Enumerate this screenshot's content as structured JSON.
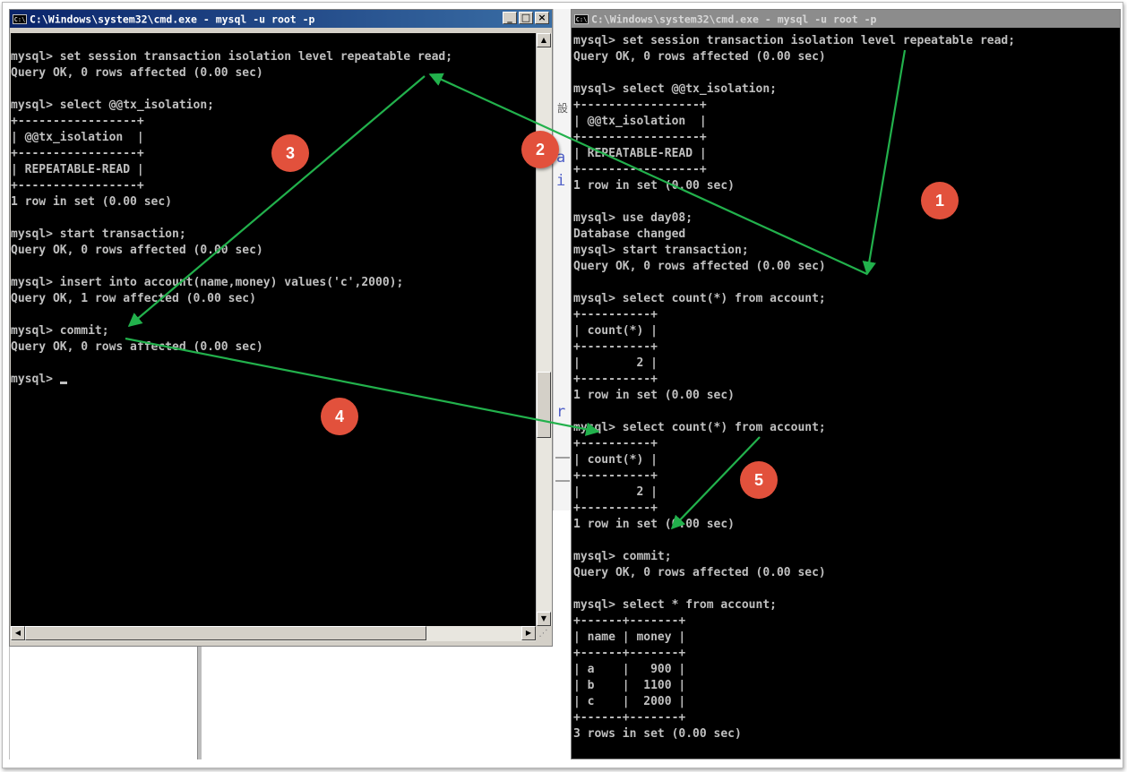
{
  "colors": {
    "terminal_bg": "#000000",
    "terminal_text": "#c0c0c0",
    "titlebar_active": "#0a246a",
    "titlebar_inactive": "#808080",
    "annotation_arrow": "#22b14c",
    "marker_fill": "#e2513c"
  },
  "icons": {
    "window_icon": "cmd-window-icon",
    "minimize": "minimize-icon",
    "maximize": "maximize-icon",
    "close": "close-icon"
  },
  "left_window": {
    "title": "C:\\Windows\\system32\\cmd.exe - mysql  -u root -p",
    "icon_text": "C:\\",
    "btn_min": "_",
    "btn_max": "□",
    "btn_close": "×",
    "lines": [
      "",
      "mysql> set session transaction isolation level repeatable read;",
      "Query OK, 0 rows affected (0.00 sec)",
      "",
      "mysql> select @@tx_isolation;",
      "+-----------------+",
      "| @@tx_isolation  |",
      "+-----------------+",
      "| REPEATABLE-READ |",
      "+-----------------+",
      "1 row in set (0.00 sec)",
      "",
      "mysql> start transaction;",
      "Query OK, 0 rows affected (0.00 sec)",
      "",
      "mysql> insert into account(name,money) values('c',2000);",
      "Query OK, 1 row affected (0.00 sec)",
      "",
      "mysql> commit;",
      "Query OK, 0 rows affected (0.00 sec)",
      "",
      "mysql> "
    ]
  },
  "right_window": {
    "title": "C:\\Windows\\system32\\cmd.exe - mysql  -u root -p",
    "icon_text": "C:\\",
    "lines": [
      "mysql> set session transaction isolation level repeatable read;",
      "Query OK, 0 rows affected (0.00 sec)",
      "",
      "mysql> select @@tx_isolation;",
      "+-----------------+",
      "| @@tx_isolation  |",
      "+-----------------+",
      "| REPEATABLE-READ |",
      "+-----------------+",
      "1 row in set (0.00 sec)",
      "",
      "mysql> use day08;",
      "Database changed",
      "mysql> start transaction;",
      "Query OK, 0 rows affected (0.00 sec)",
      "",
      "mysql> select count(*) from account;",
      "+----------+",
      "| count(*) |",
      "+----------+",
      "|        2 |",
      "+----------+",
      "1 row in set (0.00 sec)",
      "",
      "mysql> select count(*) from account;",
      "+----------+",
      "| count(*) |",
      "+----------+",
      "|        2 |",
      "+----------+",
      "1 row in set (0.00 sec)",
      "",
      "mysql> commit;",
      "Query OK, 0 rows affected (0.00 sec)",
      "",
      "mysql> select * from account;",
      "+------+-------+",
      "| name | money |",
      "+------+-------+",
      "| a    |   900 |",
      "| b    |  1100 |",
      "| c    |  2000 |",
      "+------+-------+",
      "3 rows in set (0.00 sec)"
    ]
  },
  "background_fragments": [
    "a",
    "i",
    "r",
    "設"
  ],
  "step_markers": [
    "1",
    "2",
    "3",
    "4",
    "5"
  ]
}
